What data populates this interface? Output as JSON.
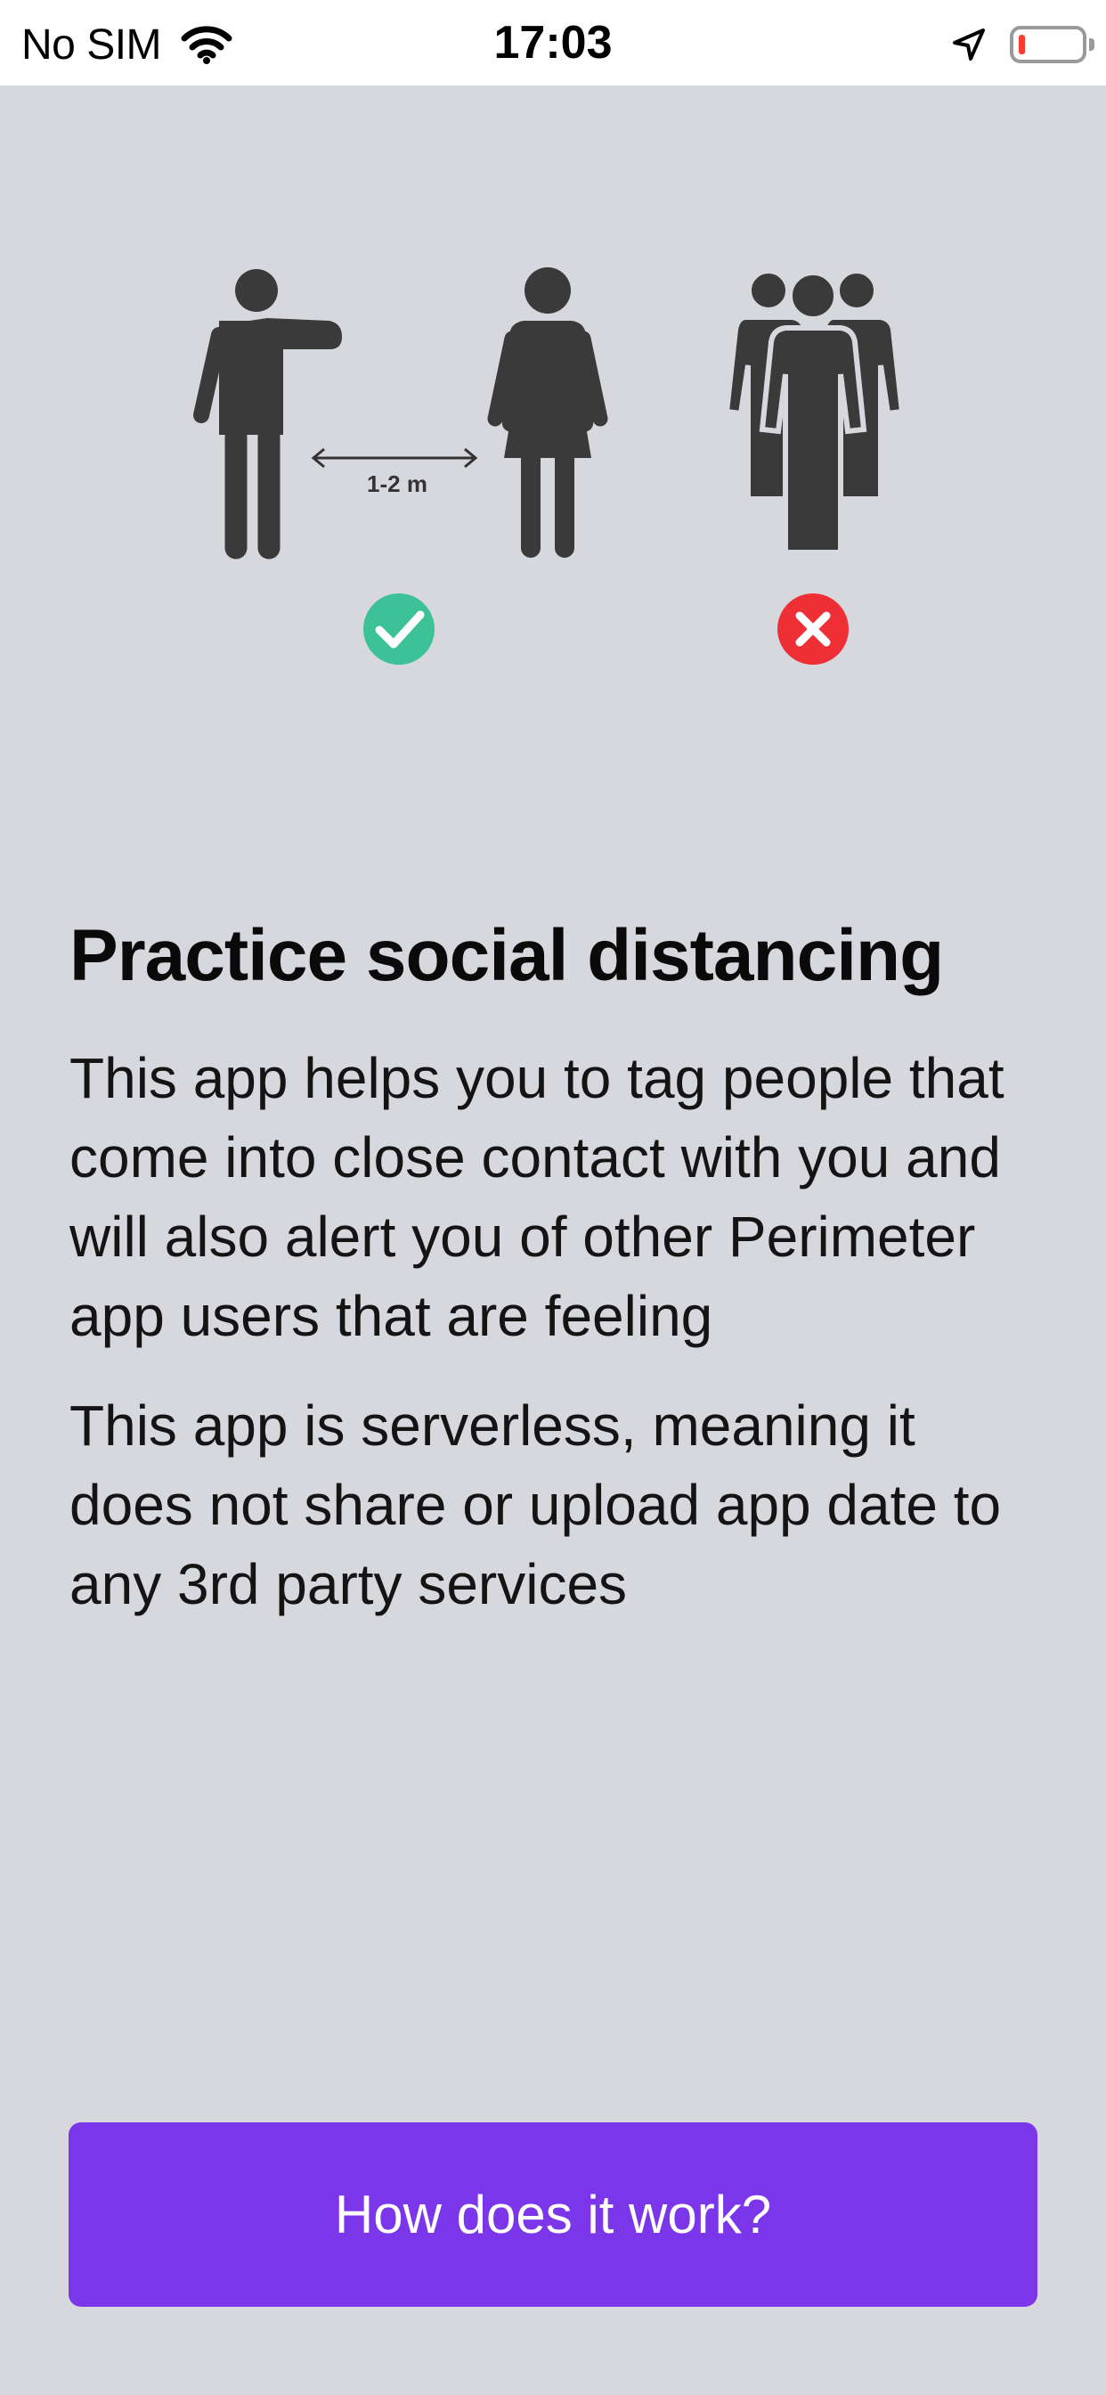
{
  "status_bar": {
    "carrier": "No SIM",
    "time": "17:03",
    "battery_level": 0.1,
    "icons": [
      "wifi-icon",
      "location-arrow-icon",
      "battery-icon"
    ]
  },
  "illustration": {
    "distance_label": "1-2 m",
    "ok_icon": "check-circle-icon",
    "bad_icon": "x-circle-icon",
    "colors": {
      "figure": "#3a3a3a",
      "ok": "#3cc296",
      "bad": "#ef2f36"
    }
  },
  "content": {
    "title": "Practice social distancing",
    "paragraph1": "This app helps you to tag people that come into close contact with you and will also alert you of other Perimeter app users that are feeling",
    "paragraph2": "This app is serverless, meaning it does not share or upload app date to any 3rd party services"
  },
  "cta": {
    "label": "How does it work?",
    "color": "#7b36ea"
  }
}
